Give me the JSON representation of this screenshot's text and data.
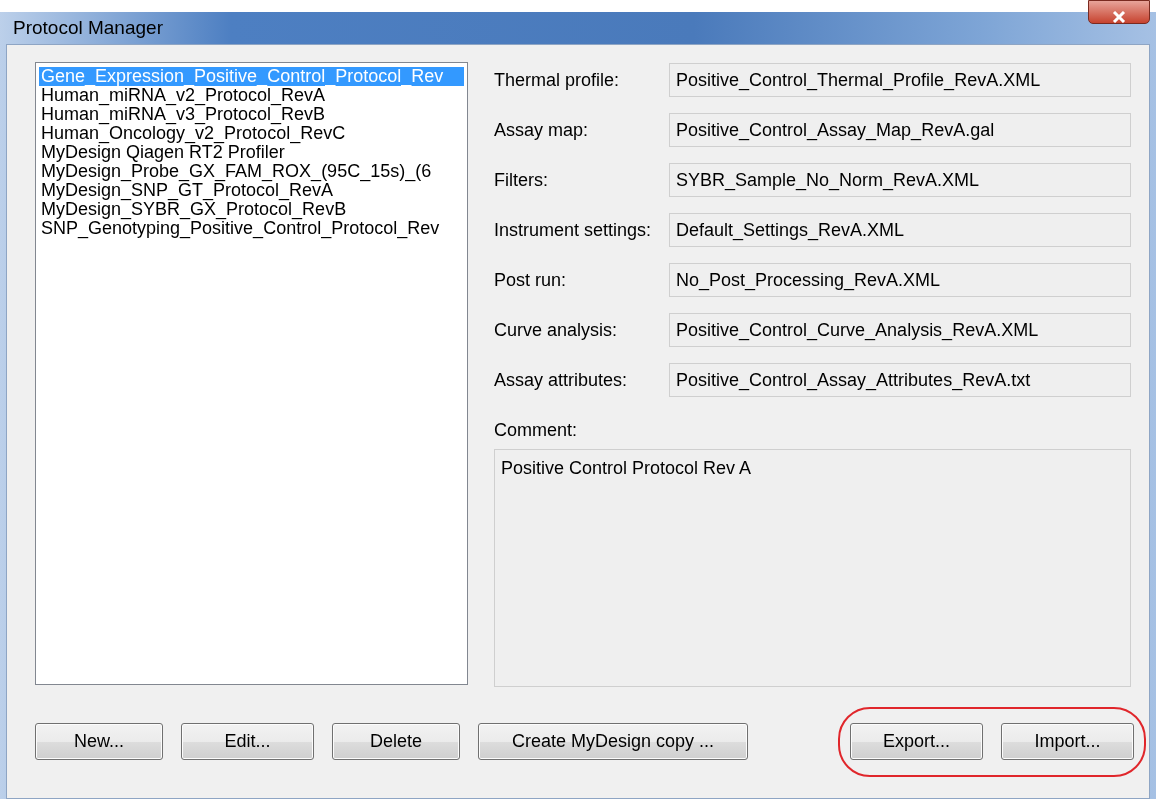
{
  "window": {
    "title": "Protocol Manager"
  },
  "protocols": [
    {
      "label": "Gene_Expression_Positive_Control_Protocol_Rev",
      "selected": true
    },
    {
      "label": "Human_miRNA_v2_Protocol_RevA",
      "selected": false
    },
    {
      "label": "Human_miRNA_v3_Protocol_RevB",
      "selected": false
    },
    {
      "label": "Human_Oncology_v2_Protocol_RevC",
      "selected": false
    },
    {
      "label": "MyDesign Qiagen RT2 Profiler",
      "selected": false
    },
    {
      "label": "MyDesign_Probe_GX_FAM_ROX_(95C_15s)_(6",
      "selected": false
    },
    {
      "label": "MyDesign_SNP_GT_Protocol_RevA",
      "selected": false
    },
    {
      "label": "MyDesign_SYBR_GX_Protocol_RevB",
      "selected": false
    },
    {
      "label": "SNP_Genotyping_Positive_Control_Protocol_Rev",
      "selected": false
    }
  ],
  "fields": [
    {
      "label": "Thermal profile:",
      "value": "Positive_Control_Thermal_Profile_RevA.XML"
    },
    {
      "label": "Assay map:",
      "value": "Positive_Control_Assay_Map_RevA.gal"
    },
    {
      "label": "Filters:",
      "value": "SYBR_Sample_No_Norm_RevA.XML"
    },
    {
      "label": "Instrument settings:",
      "value": "Default_Settings_RevA.XML"
    },
    {
      "label": "Post run:",
      "value": "No_Post_Processing_RevA.XML"
    },
    {
      "label": "Curve analysis:",
      "value": "Positive_Control_Curve_Analysis_RevA.XML"
    },
    {
      "label": "Assay attributes:",
      "value": "Positive_Control_Assay_Attributes_RevA.txt"
    }
  ],
  "comment": {
    "label": "Comment:",
    "value": "Positive Control Protocol Rev A"
  },
  "left_buttons": [
    "New...",
    "Edit...",
    "Delete",
    "Create MyDesign copy ..."
  ],
  "right_buttons": [
    "Export...",
    "Import..."
  ]
}
